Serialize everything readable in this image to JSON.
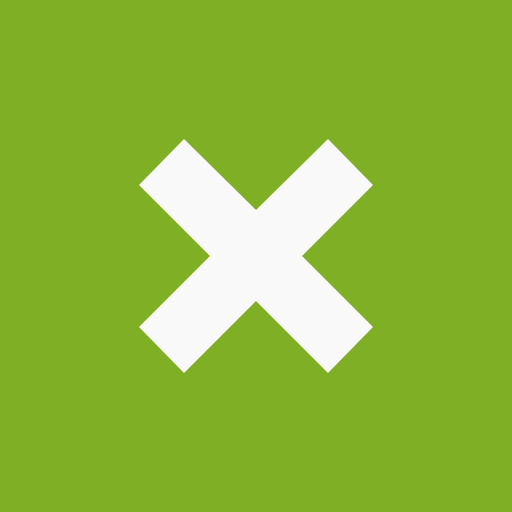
{
  "tile": {
    "icon": "close-icon",
    "background_color": "#7FAF24",
    "icon_color": "#F9F9FA"
  }
}
